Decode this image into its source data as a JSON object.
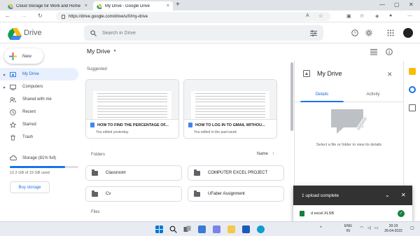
{
  "browser": {
    "tabs": [
      {
        "title": "Cloud Storage for Work and Home",
        "active": false
      },
      {
        "title": "My Drive - Google Drive",
        "active": true
      }
    ],
    "url": "https://drive.google.com/drive/u/0/my-drive"
  },
  "app": {
    "name": "Drive",
    "search_placeholder": "Search in Drive"
  },
  "sidebar": {
    "new_label": "New",
    "items": [
      {
        "label": "My Drive",
        "icon": "my-drive-icon",
        "active": true
      },
      {
        "label": "Computers",
        "icon": "computers-icon",
        "active": false
      },
      {
        "label": "Shared with me",
        "icon": "shared-icon",
        "active": false
      },
      {
        "label": "Recent",
        "icon": "clock-icon",
        "active": false
      },
      {
        "label": "Starred",
        "icon": "star-icon",
        "active": false
      },
      {
        "label": "Trash",
        "icon": "trash-icon",
        "active": false
      }
    ],
    "storage": {
      "label": "Storage (81% full)",
      "used_text": "12.2 GB of 15 GB used",
      "fraction": 0.81
    },
    "buy_label": "Buy storage"
  },
  "main": {
    "title": "My Drive",
    "suggested_label": "Suggested",
    "suggested": [
      {
        "title": "HOW TO FIND THE PERCENTAGE OF...",
        "subtitle": "You edited yesterday"
      },
      {
        "title": "HOW TO LOG IN TO GMAIL WITHOU...",
        "subtitle": "You edited in the past week"
      }
    ],
    "folders_label": "Folders",
    "sort_label": "Name",
    "folders": [
      "Classroom",
      "COMPUTER EXCEL PROJECT",
      "Cv",
      "UFaber Assignment"
    ],
    "files_label": "Files"
  },
  "details": {
    "title": "My Drive",
    "tabs": [
      "Details",
      "Activity"
    ],
    "message": "Select a file or folder to view its details"
  },
  "upload": {
    "status": "1 upload complete",
    "file": "d excel.XLSB"
  },
  "taskbar": {
    "lang_line1": "ENG",
    "lang_line2": "IN",
    "time": "20:19",
    "date": "26-04-2022"
  },
  "colors": {
    "accent": "#1a73e8",
    "active_bg": "#e8f0fe",
    "toast_bg": "#323232",
    "success": "#188038"
  }
}
